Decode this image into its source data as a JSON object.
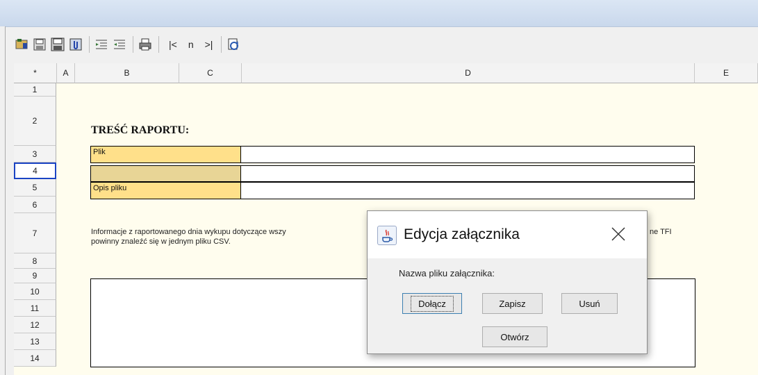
{
  "toolbar": {
    "first": "|<",
    "n": "n",
    "last": ">|"
  },
  "grid": {
    "corner": "*",
    "columns": [
      "A",
      "B",
      "C",
      "D",
      "E"
    ],
    "rows": [
      "1",
      "2",
      "3",
      "4",
      "5",
      "6",
      "7",
      "8",
      "9",
      "10",
      "11",
      "12",
      "13",
      "14"
    ]
  },
  "report": {
    "title": "TREŚĆ RAPORTU:",
    "label_file": "Plik",
    "label_desc": "Opis pliku",
    "info_line1": "Informacje z raportowanego dnia wykupu dotyczące wszy",
    "info_tail1": "ne TFI",
    "info_line2": "powinny znaleźć się w jednym pliku CSV."
  },
  "dialog": {
    "title": "Edycja załącznika",
    "label": "Nazwa pliku załącznika:",
    "btn_attach": "Dołącz",
    "btn_save": "Zapisz",
    "btn_delete": "Usuń",
    "btn_open": "Otwórz"
  }
}
